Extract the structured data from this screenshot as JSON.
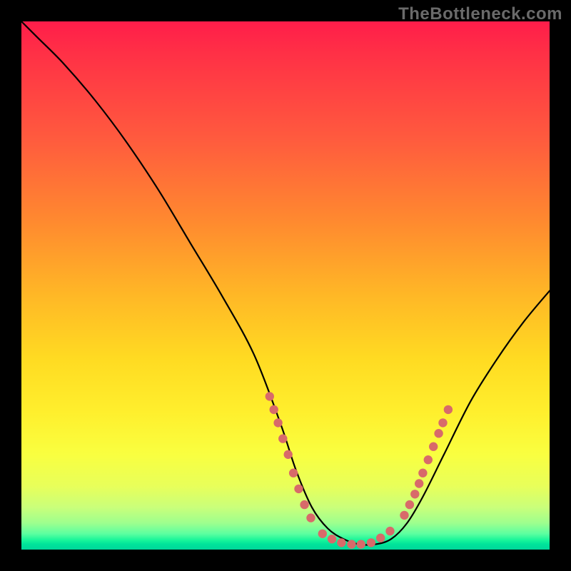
{
  "watermark": "TheBottleneck.com",
  "colors": {
    "dot": "#d86a6a",
    "stroke": "#000000",
    "green_band": "#00d79a"
  },
  "chart_data": {
    "type": "line",
    "title": "",
    "xlabel": "",
    "ylabel": "",
    "xlim": [
      0,
      100
    ],
    "ylim": [
      0,
      100
    ],
    "grid": false,
    "series": [
      {
        "name": "curve",
        "x": [
          0,
          3,
          8,
          14,
          20,
          26,
          32,
          38,
          44,
          49,
          52,
          55,
          58,
          61,
          64,
          67,
          70,
          73,
          76,
          80,
          85,
          90,
          95,
          100
        ],
        "y": [
          100,
          97,
          92,
          85,
          77,
          68,
          58,
          48,
          37,
          24,
          15,
          8,
          4,
          2,
          1,
          1,
          2,
          5,
          10,
          18,
          28,
          36,
          43,
          49
        ]
      }
    ],
    "annotations": {
      "dots_left": [
        {
          "x": 47.0,
          "y": 29.0
        },
        {
          "x": 47.8,
          "y": 26.5
        },
        {
          "x": 48.6,
          "y": 24.0
        },
        {
          "x": 49.5,
          "y": 21.0
        },
        {
          "x": 50.5,
          "y": 18.0
        },
        {
          "x": 51.5,
          "y": 14.5
        },
        {
          "x": 52.5,
          "y": 11.5
        },
        {
          "x": 53.6,
          "y": 8.5
        },
        {
          "x": 54.8,
          "y": 6.0
        }
      ],
      "dots_bottom": [
        {
          "x": 57.0,
          "y": 3.0
        },
        {
          "x": 58.8,
          "y": 2.0
        },
        {
          "x": 60.6,
          "y": 1.3
        },
        {
          "x": 62.5,
          "y": 1.0
        },
        {
          "x": 64.3,
          "y": 1.0
        },
        {
          "x": 66.2,
          "y": 1.3
        },
        {
          "x": 68.0,
          "y": 2.2
        },
        {
          "x": 69.8,
          "y": 3.5
        }
      ],
      "dots_right": [
        {
          "x": 72.5,
          "y": 6.5
        },
        {
          "x": 73.5,
          "y": 8.5
        },
        {
          "x": 74.5,
          "y": 10.5
        },
        {
          "x": 75.3,
          "y": 12.5
        },
        {
          "x": 76.0,
          "y": 14.5
        },
        {
          "x": 77.0,
          "y": 17.0
        },
        {
          "x": 78.0,
          "y": 19.5
        },
        {
          "x": 79.0,
          "y": 22.0
        },
        {
          "x": 79.8,
          "y": 24.0
        },
        {
          "x": 80.8,
          "y": 26.5
        }
      ]
    }
  }
}
